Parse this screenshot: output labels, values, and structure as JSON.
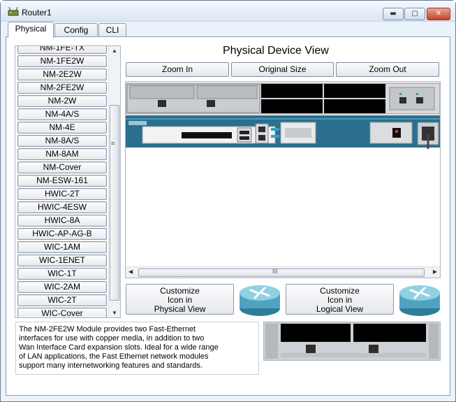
{
  "window": {
    "title": "Router1",
    "minimize_glyph": "▬",
    "maximize_glyph": "▢",
    "close_glyph": "✕"
  },
  "tabs": [
    {
      "label": "Physical",
      "active": true
    },
    {
      "label": "Config",
      "active": false
    },
    {
      "label": "CLI",
      "active": false
    }
  ],
  "modules": {
    "partial_top": "NM-1FE-TX",
    "items": [
      "NM-1FE2W",
      "NM-2E2W",
      "NM-2FE2W",
      "NM-2W",
      "NM-4A/S",
      "NM-4E",
      "NM-8A/S",
      "NM-8AM",
      "NM-Cover",
      "NM-ESW-161",
      "HWIC-2T",
      "HWIC-4ESW",
      "HWIC-8A",
      "HWIC-AP-AG-B",
      "WIC-1AM",
      "WIC-1ENET",
      "WIC-1T",
      "WIC-2AM",
      "WIC-2T",
      "WIC-Cover"
    ],
    "scroll_up": "▲",
    "scroll_down": "▼",
    "grip": "≡"
  },
  "device_view": {
    "title": "Physical Device View",
    "zoom_in": "Zoom In",
    "original_size": "Original Size",
    "zoom_out": "Zoom Out",
    "scroll_left": "◀",
    "scroll_right": "▶",
    "grip": "III"
  },
  "customize": {
    "physical": [
      "Customize",
      "Icon in",
      "Physical View"
    ],
    "logical": [
      "Customize",
      "Icon in",
      "Logical View"
    ]
  },
  "description": {
    "lines": [
      "The NM-2FE2W Module provides two Fast-Ethernet",
      "interfaces for use with copper media, in addition to two",
      "Wan Interface Card expansion slots. Ideal for a wide range",
      "of LAN applications, the Fast Ethernet network modules",
      "support many internetworking features and standards."
    ]
  },
  "colors": {
    "chassis": "#2a6f8f",
    "slot_black": "#000000",
    "module_grey": "#c9ccd0",
    "router_icon": "#4fa3c0"
  },
  "icons": {
    "app": "router-app-icon",
    "router": "router-icon"
  }
}
